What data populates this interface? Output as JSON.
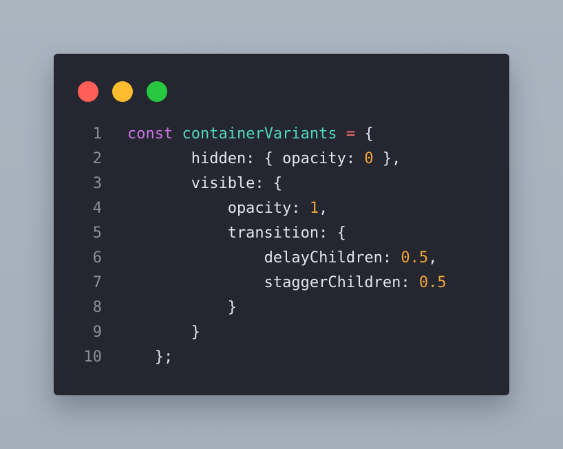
{
  "window": {
    "traffic_lights": [
      {
        "name": "close",
        "color": "#ff5f57"
      },
      {
        "name": "minimize",
        "color": "#febc2e"
      },
      {
        "name": "zoom",
        "color": "#28c840"
      }
    ]
  },
  "code": {
    "lines": [
      {
        "number": "1",
        "tokens": [
          {
            "text": "const",
            "type": "keyword"
          },
          {
            "text": " ",
            "type": "punc"
          },
          {
            "text": "containerVariants",
            "type": "ident"
          },
          {
            "text": " ",
            "type": "punc"
          },
          {
            "text": "=",
            "type": "op"
          },
          {
            "text": " {",
            "type": "punc"
          }
        ]
      },
      {
        "number": "2",
        "tokens": [
          {
            "text": "       hidden: { opacity: ",
            "type": "punc"
          },
          {
            "text": "0",
            "type": "num"
          },
          {
            "text": " },",
            "type": "punc"
          }
        ]
      },
      {
        "number": "3",
        "tokens": [
          {
            "text": "       visible: {",
            "type": "punc"
          }
        ]
      },
      {
        "number": "4",
        "tokens": [
          {
            "text": "           opacity: ",
            "type": "punc"
          },
          {
            "text": "1",
            "type": "num"
          },
          {
            "text": ",",
            "type": "punc"
          }
        ]
      },
      {
        "number": "5",
        "tokens": [
          {
            "text": "           transition: {",
            "type": "punc"
          }
        ]
      },
      {
        "number": "6",
        "tokens": [
          {
            "text": "               delayChildren: ",
            "type": "punc"
          },
          {
            "text": "0.5",
            "type": "num"
          },
          {
            "text": ",",
            "type": "punc"
          }
        ]
      },
      {
        "number": "7",
        "tokens": [
          {
            "text": "               staggerChildren: ",
            "type": "punc"
          },
          {
            "text": "0.5",
            "type": "num"
          }
        ]
      },
      {
        "number": "8",
        "tokens": [
          {
            "text": "           }",
            "type": "punc"
          }
        ]
      },
      {
        "number": "9",
        "tokens": [
          {
            "text": "       }",
            "type": "punc"
          }
        ]
      },
      {
        "number": "10",
        "tokens": [
          {
            "text": "   };",
            "type": "punc"
          }
        ]
      }
    ]
  }
}
